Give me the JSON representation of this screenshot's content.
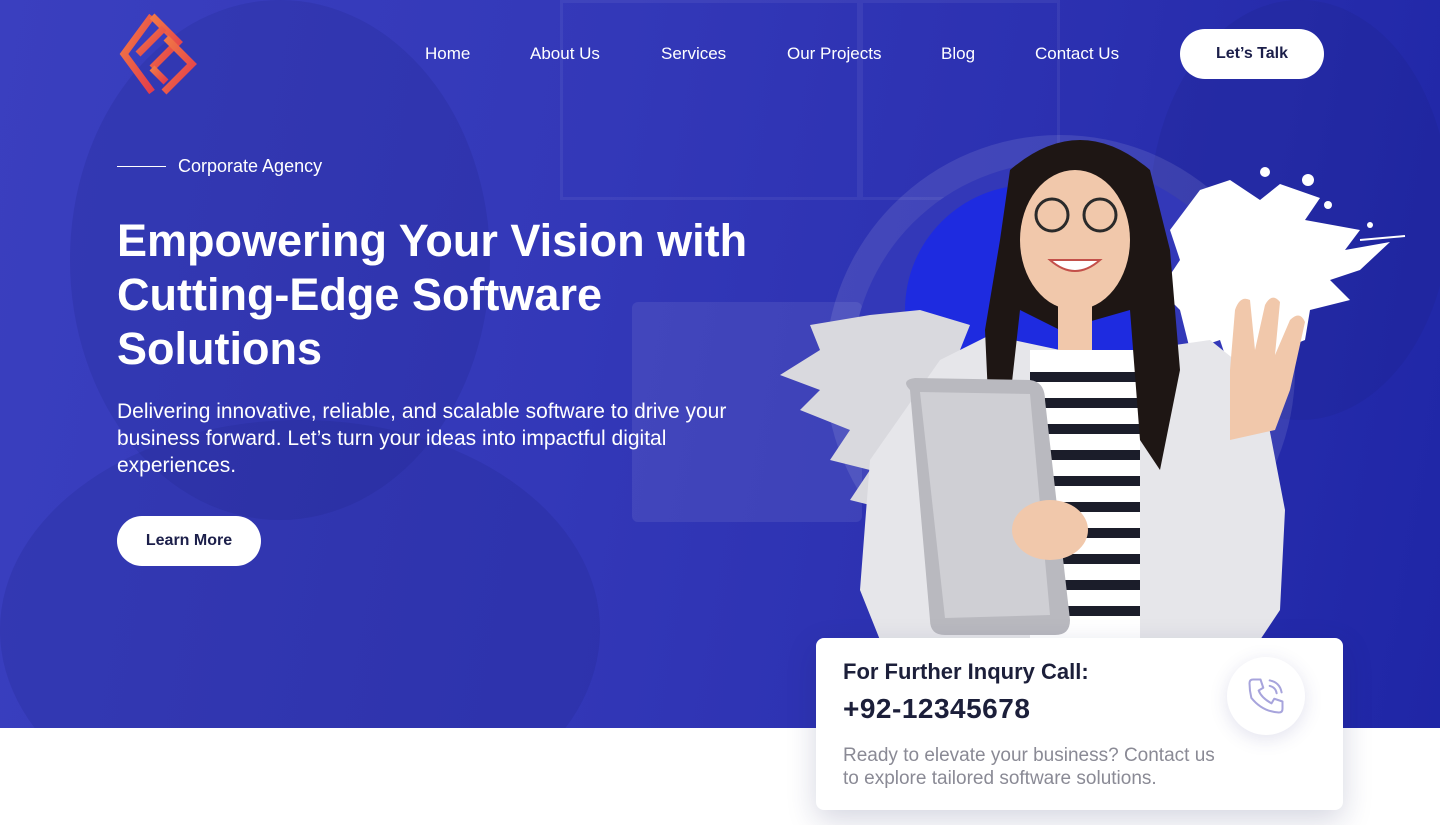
{
  "brand": {
    "logo_icon": "brand-logo-icon",
    "colors": {
      "logo_primary": "#e8453c",
      "logo_secondary": "#f27a45"
    }
  },
  "nav": {
    "items": [
      "Home",
      "About Us",
      "Services",
      "Our Projects",
      "Blog",
      "Contact Us"
    ],
    "cta_label": "Let’s Talk"
  },
  "hero": {
    "eyebrow": "Corporate Agency",
    "headline_lines": [
      "Empowering Your Vision with",
      "Cutting-Edge Software",
      "Solutions"
    ],
    "subtext": "Delivering innovative, reliable, and scalable software to drive your business forward. Let’s turn your ideas into impactful digital experiences.",
    "button_label": "Learn More",
    "colors": {
      "background": "#3338b8",
      "accent_circle": "#1e2be0"
    }
  },
  "contact_card": {
    "title": "For Further Inqury Call:",
    "phone": "+92-12345678",
    "description": "Ready to elevate your business? Contact us to explore tailored software solutions.",
    "icon": "phone-icon"
  }
}
